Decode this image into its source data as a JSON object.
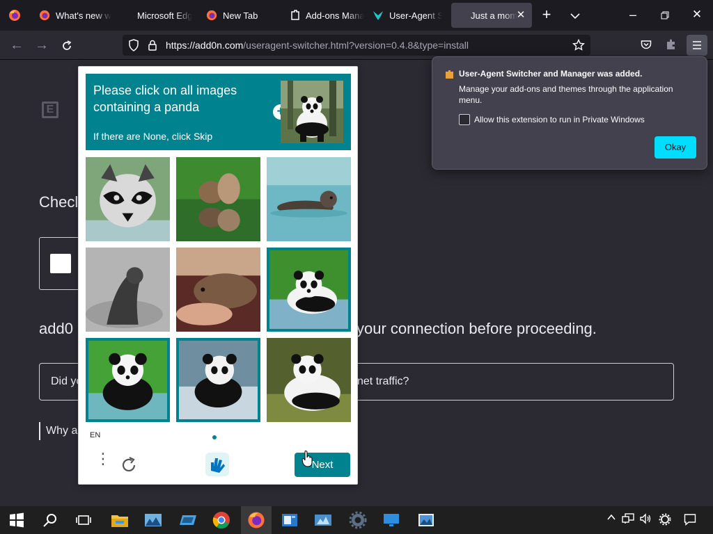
{
  "browser": {
    "tabs": [
      {
        "label": "What's new w",
        "icon": "firefox-icon",
        "active": false
      },
      {
        "label": "Microsoft Edg",
        "icon": "",
        "active": false
      },
      {
        "label": "New Tab",
        "icon": "firefox-icon",
        "active": false
      },
      {
        "label": "Add-ons Mana",
        "icon": "puzzle-icon",
        "active": false
      },
      {
        "label": "User-Agent Sw",
        "icon": "useragent-switcher-icon",
        "active": false
      },
      {
        "label": "Just a mom",
        "icon": "",
        "active": true
      }
    ],
    "url_host": "https://add0n.com",
    "url_path": "/useragent-switcher.html?version=0.4.8&type=install"
  },
  "page": {
    "check_partial": "Checl",
    "heading_left": "add0",
    "heading_right": "your connection before proceeding.",
    "question_left": "Did yo",
    "question_right": "net traffic?",
    "why_partial": "Why a"
  },
  "captcha": {
    "prompt": "Please click on all images containing a panda",
    "sub": "If there are None, click Skip",
    "lang": "EN",
    "next_label": "Next",
    "tiles": [
      {
        "subject": "raccoon",
        "selected": false
      },
      {
        "subject": "squirrel",
        "selected": false
      },
      {
        "subject": "otter",
        "selected": false
      },
      {
        "subject": "seal",
        "selected": false
      },
      {
        "subject": "otter-on-hand",
        "selected": false
      },
      {
        "subject": "panda",
        "selected": true
      },
      {
        "subject": "panda",
        "selected": true
      },
      {
        "subject": "panda",
        "selected": true
      },
      {
        "subject": "panda",
        "selected": false
      }
    ]
  },
  "notification": {
    "title": "User-Agent Switcher and Manager was added.",
    "body": "Manage your add-ons and themes through the application menu.",
    "checkbox_label": "Allow this extension to run in Private Windows",
    "checkbox_checked": false,
    "okay_label": "Okay"
  },
  "colors": {
    "captcha_accent": "#00838f",
    "okay_button": "#00ddff",
    "browser_chrome": "#1c1b22",
    "page_background": "#2b2a33"
  }
}
